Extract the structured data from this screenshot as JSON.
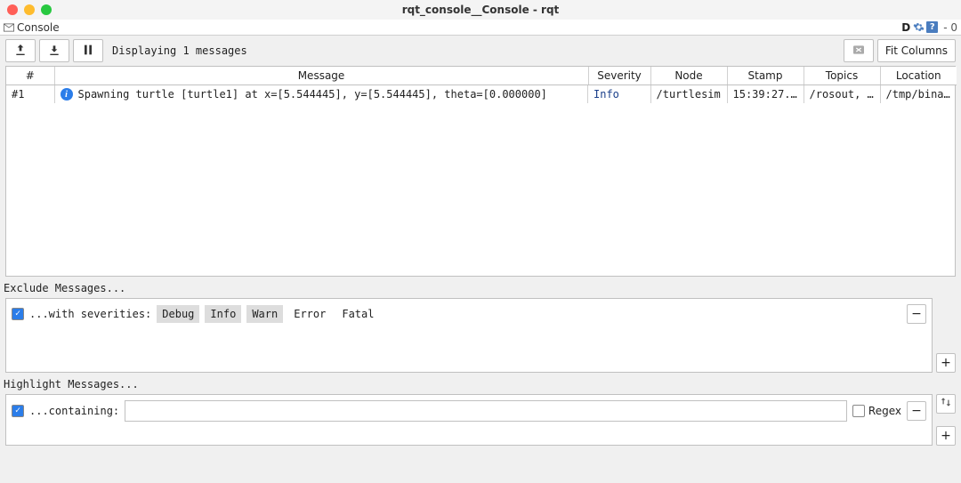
{
  "window": {
    "title": "rqt_console__Console - rqt",
    "tab_label": "Console",
    "right_controls": {
      "letter": "D",
      "gear": "gear",
      "help": "?",
      "count": "- 0"
    }
  },
  "toolbar": {
    "export_tooltip": "Export",
    "import_tooltip": "Import",
    "pause_tooltip": "Pause",
    "displaying": "Displaying 1 messages",
    "clear_tooltip": "Clear",
    "fit_columns": "Fit Columns"
  },
  "table": {
    "headers": [
      "#",
      "Message",
      "Severity",
      "Node",
      "Stamp",
      "Topics",
      "Location"
    ],
    "rows": [
      {
        "num": "#1",
        "message": "Spawning turtle [turtle1] at x=[5.544445], y=[5.544445], theta=[0.000000]",
        "severity": "Info",
        "node": "/turtlesim",
        "stamp": "15:39:27.0…",
        "topics": "/rosout, /…",
        "location": "/tmp/binar…"
      }
    ]
  },
  "exclude": {
    "section": "Exclude Messages...",
    "label": "...with severities:",
    "severities": [
      "Debug",
      "Info",
      "Warn",
      "Error",
      "Fatal"
    ],
    "selected_severities": [
      "Debug",
      "Info",
      "Warn"
    ],
    "minus": "−",
    "plus": "+"
  },
  "highlight": {
    "section": "Highlight Messages...",
    "label": "...containing:",
    "value": "",
    "regex_label": "Regex",
    "minus": "−",
    "plus": "+",
    "swap": "⇅"
  }
}
